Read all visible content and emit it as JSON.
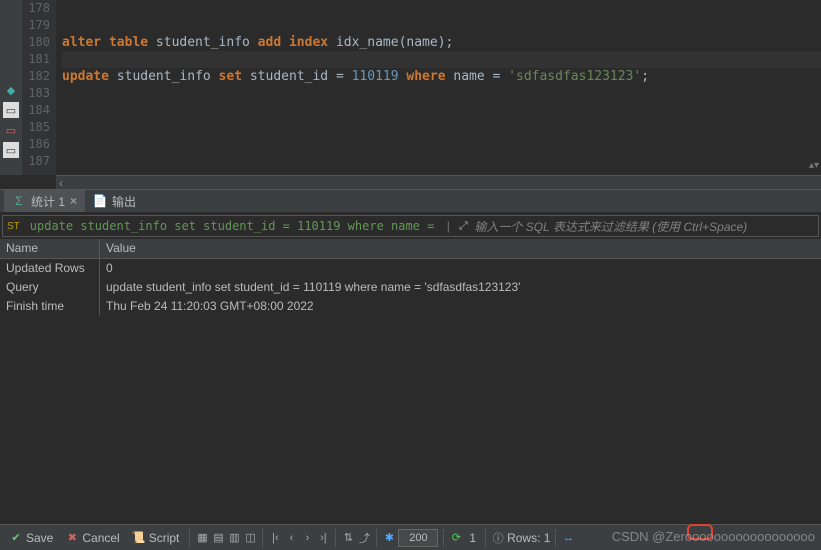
{
  "editor": {
    "lines": [
      "178",
      "179",
      "180",
      "181",
      "182",
      "183",
      "184",
      "185",
      "186",
      "187"
    ],
    "code179": {
      "pre": "alter table ",
      "t1": "student_info ",
      "add": "add ",
      "idx": "index ",
      "t2": "idx_name(",
      "col": "name",
      "end": ");"
    },
    "code181": {
      "pre": "update ",
      "t1": "student_info ",
      "set": "set ",
      "c1": "student_id = ",
      "num": "110119",
      "whr": " where ",
      "c2": "name = ",
      "str": "'sdfasdfas123123'",
      "end": ";"
    }
  },
  "tabs": {
    "tab1": {
      "label": "统计 1",
      "icon": "Σ",
      "close": "×"
    },
    "tab2": {
      "label": "输出",
      "icon": "📄"
    }
  },
  "sqlbar": {
    "query": "update student_info set student_id = 110119 where name = ",
    "icon": "⤢",
    "hint": "输入一个 SQL 表达式来过滤结果 (使用 Ctrl+Space)"
  },
  "resultHeaders": {
    "c1": "Name",
    "c2": "Value"
  },
  "results": [
    {
      "name": "Updated Rows",
      "value": "0"
    },
    {
      "name": "Query",
      "value": "update student_info set student_id = 110119 where name = 'sdfasdfas123123'"
    },
    {
      "name": "Finish time",
      "value": "Thu Feb 24 11:20:03 GMT+08:00 2022"
    }
  ],
  "bottom": {
    "save": "Save",
    "cancel": "Cancel",
    "script": "Script",
    "pageSize": "200",
    "rowCount": "1",
    "rowsLabel": "Rows: 1"
  },
  "watermark": "CSDN @Zeroooooooooooooooooo"
}
